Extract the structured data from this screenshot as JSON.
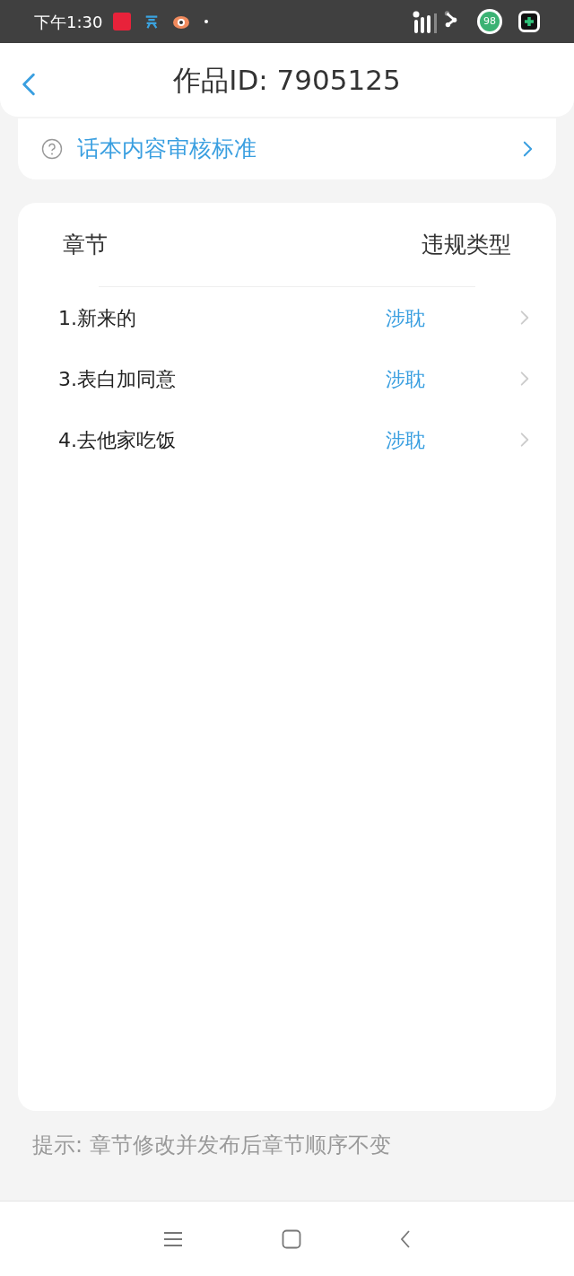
{
  "status_bar": {
    "time": "下午1:30",
    "battery": "98"
  },
  "header": {
    "title": "作品ID: 7905125"
  },
  "standards_link": {
    "label": "话本内容审核标准"
  },
  "table": {
    "columns": [
      "章节",
      "违规类型"
    ],
    "rows": [
      {
        "chapter": "1.新来的",
        "violation": "涉耽"
      },
      {
        "chapter": "3.表白加同意",
        "violation": "涉耽"
      },
      {
        "chapter": "4.去他家吃饭",
        "violation": "涉耽"
      }
    ]
  },
  "tip": "提示: 章节修改并发布后章节顺序不变"
}
